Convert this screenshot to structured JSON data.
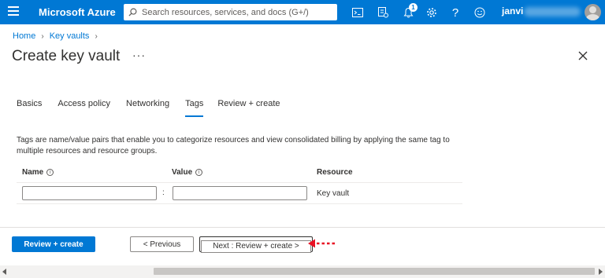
{
  "header": {
    "brand": "Microsoft Azure",
    "search_placeholder": "Search resources, services, and docs (G+/)",
    "notification_count": "1",
    "user_name": "janvi",
    "accent_color": "#0078d4"
  },
  "breadcrumb": {
    "items": [
      "Home",
      "Key vaults"
    ]
  },
  "page": {
    "title": "Create key vault",
    "more": "···"
  },
  "tabs": [
    "Basics",
    "Access policy",
    "Networking",
    "Tags",
    "Review + create"
  ],
  "active_tab": "Tags",
  "description": "Tags are name/value pairs that enable you to categorize resources and view consolidated billing by applying the same tag to multiple resources and resource groups.",
  "table": {
    "headers": {
      "name": "Name",
      "value": "Value",
      "resource": "Resource"
    },
    "info_glyph": "i",
    "separator": ":",
    "row": {
      "name": "",
      "value": "",
      "resource": "Key vault"
    }
  },
  "footer": {
    "review_create_label": "Review + create",
    "previous_label": "< Previous",
    "next_label": "Next : Review + create >"
  },
  "icons": [
    "hamburger-icon",
    "search-icon",
    "cloud-shell-icon",
    "directory-filter-icon",
    "notifications-icon",
    "settings-icon",
    "help-icon",
    "feedback-icon",
    "close-icon",
    "red-arrow-annotation"
  ]
}
